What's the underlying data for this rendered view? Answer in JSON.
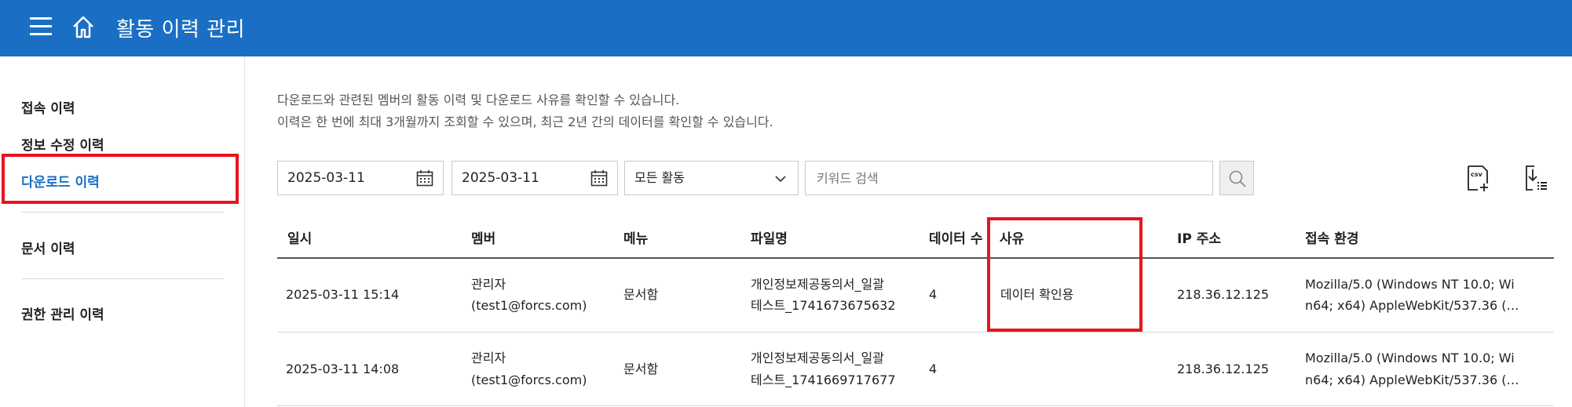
{
  "header": {
    "title": "활동 이력 관리",
    "menu_icon": "hamburger-icon",
    "home_icon": "home-icon"
  },
  "sidebar": {
    "items": [
      {
        "label": "접속 이력"
      },
      {
        "label": "정보 수정 이력"
      },
      {
        "label": "다운로드 이력",
        "active": true
      },
      {
        "label": "문서 이력"
      },
      {
        "label": "권한 관리 이력"
      }
    ]
  },
  "description": {
    "line1": "다운로드와 관련된 멤버의 활동 이력 및 다운로드 사유를 확인할 수 있습니다.",
    "line2": "이력은 한 번에 최대 3개월까지 조회할 수 있으며, 최근 2년 간의 데이터를 확인할 수 있습니다."
  },
  "filters": {
    "start_date": "2025-03-11",
    "end_date": "2025-03-11",
    "activity_select": "모든 활동",
    "search_placeholder": "키워드 검색"
  },
  "table": {
    "headers": [
      "일시",
      "멤버",
      "메뉴",
      "파일명",
      "데이터 수",
      "사유",
      "IP 주소",
      "접속 환경"
    ],
    "rows": [
      {
        "datetime": "2025-03-11 15:14",
        "member_name": "관리자",
        "member_email": "(test1@forcs.com)",
        "menu": "문서함",
        "file_line1": "개인정보제공동의서_일괄",
        "file_line2": "테스트_1741673675632",
        "count": "4",
        "reason": "데이터 확인용",
        "ip": "218.36.12.125",
        "env_line1": "Mozilla/5.0 (Windows NT 10.0; Wi",
        "env_line2": "n64; x64) AppleWebKit/537.36 (…"
      },
      {
        "datetime": "2025-03-11 14:08",
        "member_name": "관리자",
        "member_email": "(test1@forcs.com)",
        "menu": "문서함",
        "file_line1": "개인정보제공동의서_일괄",
        "file_line2": "테스트_1741669717677",
        "count": "4",
        "reason": "",
        "ip": "218.36.12.125",
        "env_line1": "Mozilla/5.0 (Windows NT 10.0; Wi",
        "env_line2": "n64; x64) AppleWebKit/537.36 (…"
      }
    ]
  },
  "colors": {
    "header_bg": "#1a6fc4",
    "active_nav": "#1a6fc4",
    "highlight": "#e8141e"
  }
}
